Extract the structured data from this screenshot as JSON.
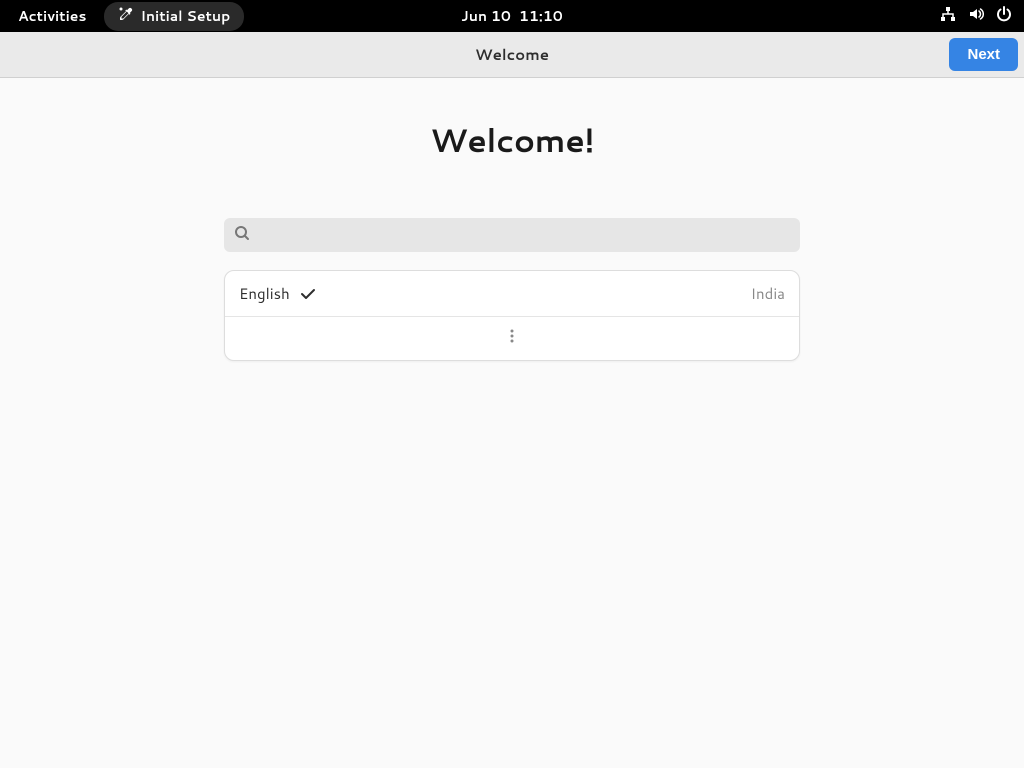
{
  "topbar": {
    "activities": "Activities",
    "app_name": "Initial Setup",
    "date": "Jun 10",
    "time": "11:10"
  },
  "headerbar": {
    "title": "Welcome",
    "next_button": "Next"
  },
  "page": {
    "heading": "Welcome!"
  },
  "search": {
    "placeholder": ""
  },
  "languages": [
    {
      "name": "English",
      "region": "India",
      "selected": true
    }
  ]
}
